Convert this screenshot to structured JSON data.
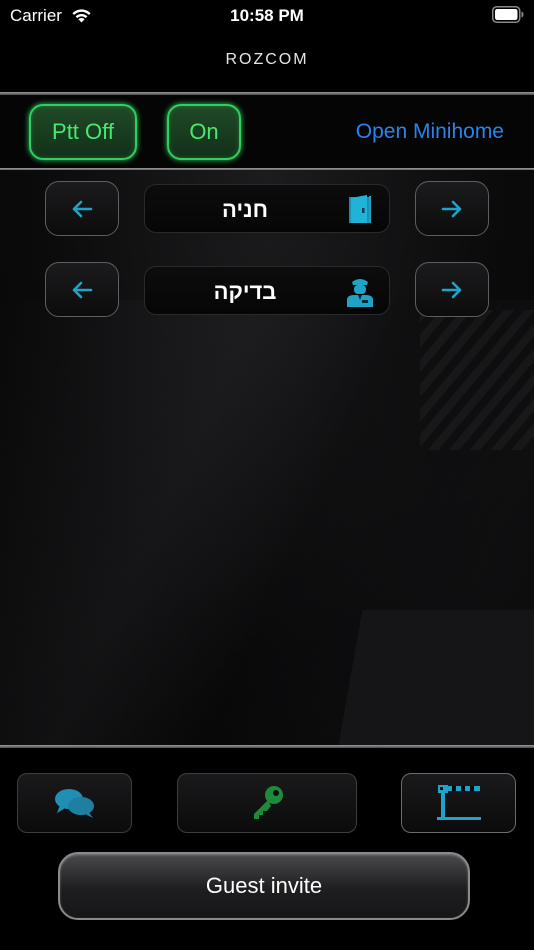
{
  "status_bar": {
    "carrier": "Carrier",
    "time": "10:58 PM"
  },
  "header": {
    "logo_text": "ROZCOM"
  },
  "toolbar": {
    "ptt_label": "Ptt Off",
    "on_label": "On",
    "open_minihome_label": "Open Minihome"
  },
  "selectors": [
    {
      "label": "חניה",
      "icon": "door-icon"
    },
    {
      "label": "בדיקה",
      "icon": "guard-icon"
    }
  ],
  "bottom_bar": {
    "chat_icon": "chat-bubbles-icon",
    "key_icon": "key-icon",
    "gate_icon": "barrier-gate-icon"
  },
  "guest_invite_label": "Guest invite",
  "colors": {
    "accent_green": "#49e86f",
    "link_blue": "#2a84ea",
    "icon_cyan": "#1fa4c8",
    "key_green": "#1f8a3a"
  }
}
